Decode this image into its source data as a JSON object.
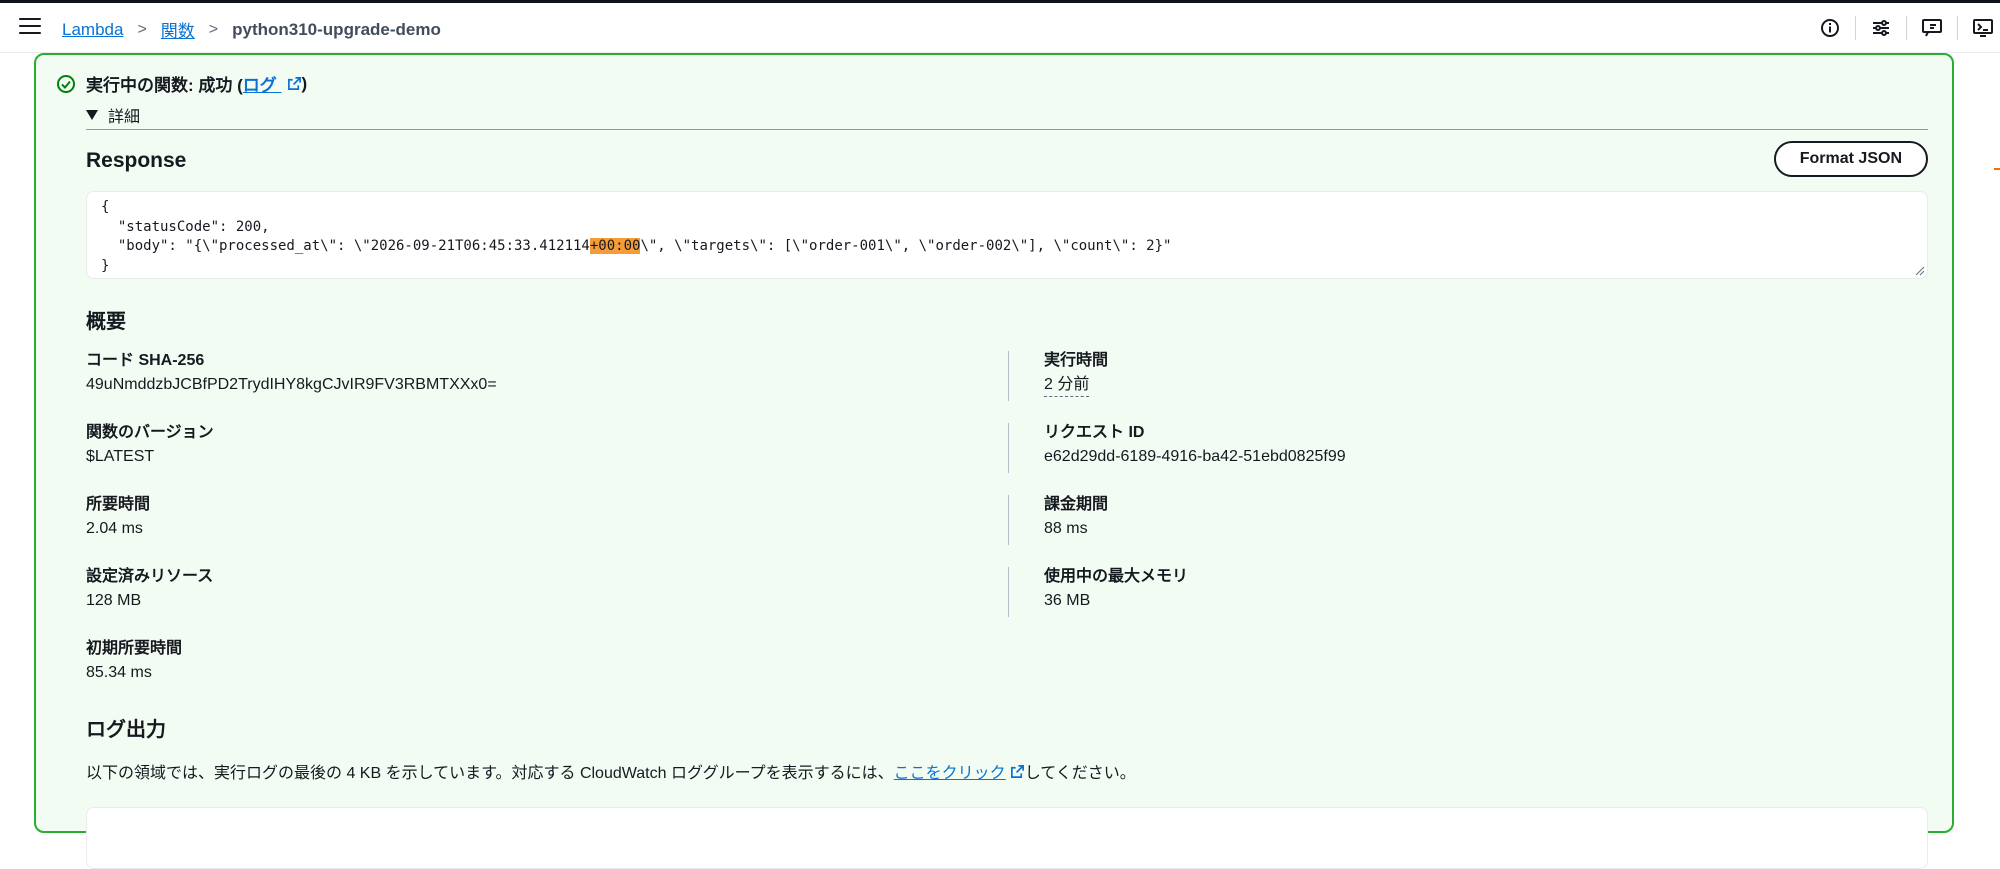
{
  "breadcrumb": {
    "service": "Lambda",
    "functions": "関数",
    "current": "python310-upgrade-demo"
  },
  "header_icons": [
    "info-icon",
    "settings-toggle-icon",
    "feedback-icon",
    "cloudshell-icon"
  ],
  "status": {
    "prefix": "実行中の関数: 成功 (",
    "log_link": "ログ",
    "suffix": ")"
  },
  "details_label": "詳細",
  "response": {
    "title": "Response",
    "format_button": "Format JSON",
    "line1": "{",
    "line2": "  \"statusCode\": 200,",
    "line3_before": "  \"body\": \"{\\\"processed_at\\\": \\\"2026-09-21T06:45:33.412114",
    "line3_highlight": "+00:00",
    "line3_after": "\\\", \\\"targets\\\": [\\\"order-001\\\", \\\"order-002\\\"], \\\"count\\\": 2}\"",
    "line4": "}"
  },
  "summary": {
    "title": "概要",
    "code_sha_label": "コード SHA-256",
    "code_sha_value": "49uNmddzbJCBfPD2TrydIHY8kgCJvIR9FV3RBMTXXx0=",
    "exec_time_label": "実行時間",
    "exec_time_value": "2 分前",
    "version_label": "関数のバージョン",
    "version_value": "$LATEST",
    "request_id_label": "リクエスト ID",
    "request_id_value": "e62d29dd-6189-4916-ba42-51ebd0825f99",
    "duration_label": "所要時間",
    "duration_value": "2.04 ms",
    "billed_label": "課金期間",
    "billed_value": "88 ms",
    "resources_label": "設定済みリソース",
    "resources_value": "128 MB",
    "max_memory_label": "使用中の最大メモリ",
    "max_memory_value": "36 MB",
    "init_label": "初期所要時間",
    "init_value": "85.34 ms"
  },
  "log_output": {
    "title": "ログ出力",
    "desc_before": "以下の領域では、実行ログの最後の 4 KB を示しています。対応する CloudWatch ロググループを表示するには、",
    "link": "ここをクリック",
    "desc_after": "してください。"
  },
  "colors": {
    "success_border": "#29ad32",
    "success_bg": "#f2fcf3",
    "link": "#0972d3",
    "highlight": "#f59c38"
  }
}
